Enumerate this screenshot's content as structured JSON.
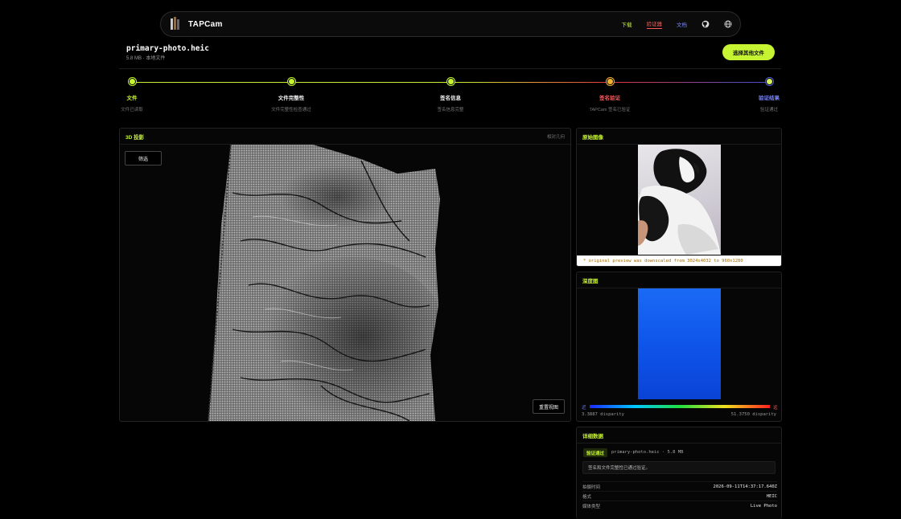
{
  "nav": {
    "brand": "TAPCam",
    "links": {
      "download": "下载",
      "verifier": "验证器",
      "docs": "文档"
    },
    "icons": [
      "tapcam-logo-icon",
      "github-icon",
      "globe-icon"
    ]
  },
  "file": {
    "name": "primary-photo.heic",
    "meta": "5.8 MB · 本地文件",
    "choose_label": "选择其他文件"
  },
  "steps": [
    {
      "title": "文件",
      "sub": "文件已读取",
      "color": "#c6f432"
    },
    {
      "title": "文件完整性",
      "sub": "文件完整性检查通过",
      "color": "#eeeeee"
    },
    {
      "title": "签名信息",
      "sub": "签名信息完整",
      "color": "#eeeeee"
    },
    {
      "title": "签名验证",
      "sub": "TAPCam 签名已验证",
      "color": "#ff5a5a"
    },
    {
      "title": "验证结果",
      "sub": "验证通过",
      "color": "#7a86ff"
    }
  ],
  "projection": {
    "title": "3D 投影",
    "tag": "相对几何",
    "filter_label": "筛选",
    "reset_label": "重置视图"
  },
  "original": {
    "title": "原始图像",
    "note": "* original preview was downscaled from 3024x4032 to 960x1280"
  },
  "depth": {
    "title": "深度图",
    "near": "近",
    "far": "远",
    "min": "3.3887 disparity",
    "max": "51.3750 disparity"
  },
  "details": {
    "title": "详细数据",
    "badge": "验证通过",
    "summary": "primary-photo.heic · 5.8 MB",
    "message": "签名和文件完整性已通过验证。",
    "rows": [
      {
        "label": "拍摄时间",
        "value": "2026-09-11T14:37:17.640Z"
      },
      {
        "label": "格式",
        "value": "HEIC"
      },
      {
        "label": "媒体类型",
        "value": "Live Photo"
      }
    ]
  },
  "colors": {
    "accent": "#c6f432",
    "alert": "#ff5a5a",
    "link": "#7a86ff"
  }
}
